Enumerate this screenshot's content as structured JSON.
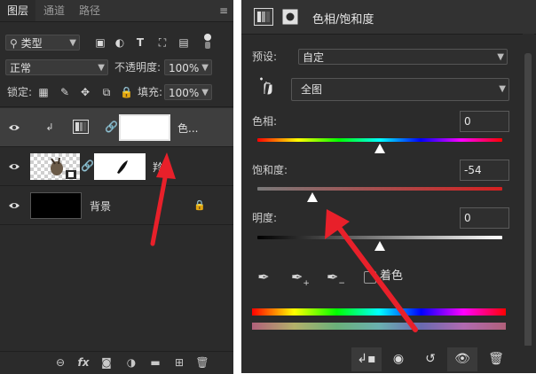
{
  "layers_panel": {
    "tabs": [
      "图层",
      "通道",
      "路径"
    ],
    "filter": {
      "kind_label": "类型"
    },
    "blend_mode": "正常",
    "opacity_label": "不透明度:",
    "opacity_value": "100%",
    "lock_label": "锁定:",
    "fill_label": "填充:",
    "fill_value": "100%",
    "layers": [
      {
        "name": "色...",
        "type": "adjustment-hue-saturation",
        "visible": true,
        "selected": true
      },
      {
        "name": "羚",
        "type": "smart-object-with-mask",
        "visible": true,
        "selected": false
      },
      {
        "name": "背景",
        "type": "background",
        "visible": true,
        "locked": true,
        "selected": false
      }
    ]
  },
  "properties_panel": {
    "title": "色相/饱和度",
    "preset_label": "预设:",
    "preset_value": "自定",
    "channel_value": "全图",
    "hue": {
      "label": "色相:",
      "value": "0"
    },
    "saturation": {
      "label": "饱和度:",
      "value": "-54"
    },
    "lightness": {
      "label": "明度:",
      "value": "0"
    },
    "colorize_label": "着色",
    "colorize_checked": false
  },
  "colors": {
    "panel_bg": "#2b2b2b",
    "arrow_red": "#e8202a"
  }
}
